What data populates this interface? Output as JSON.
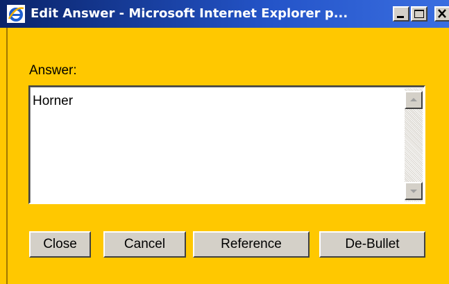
{
  "window": {
    "title": "Edit Answer - Microsoft Internet Explorer p..."
  },
  "titlebar_buttons": {
    "minimize_icon": "minimize-icon",
    "maximize_icon": "maximize-icon",
    "close_icon": "close-icon"
  },
  "form": {
    "answer_label": "Answer:",
    "answer_value": "Horner"
  },
  "buttons": {
    "close": "Close",
    "cancel": "Cancel",
    "reference": "Reference",
    "debullet": "De-Bullet"
  },
  "colors": {
    "background": "#ffc800",
    "titlebar": "#0a246a",
    "button_face": "#d4d0c8"
  }
}
